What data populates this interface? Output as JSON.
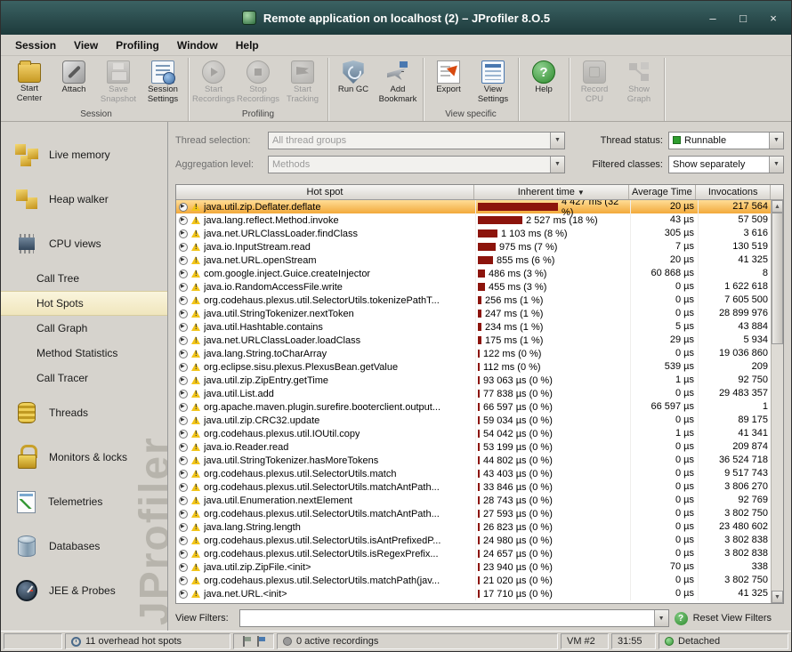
{
  "window": {
    "title": "Remote application on localhost (2) – JProfiler 8.O.5",
    "controls": {
      "minimize": "–",
      "maximize": "□",
      "close": "×"
    }
  },
  "menu": [
    "Session",
    "View",
    "Profiling",
    "Window",
    "Help"
  ],
  "toolbar": {
    "groups": [
      {
        "label": "Session",
        "buttons": [
          {
            "name": "start-center",
            "label": "Start Center",
            "disabled": false
          },
          {
            "name": "attach",
            "label": "Attach",
            "disabled": false
          },
          {
            "name": "save-snapshot",
            "label": "Save Snapshot",
            "disabled": true
          },
          {
            "name": "session-settings",
            "label": "Session Settings",
            "disabled": false
          }
        ]
      },
      {
        "label": "Profiling",
        "buttons": [
          {
            "name": "start-recordings",
            "label": "Start Recordings",
            "disabled": true
          },
          {
            "name": "stop-recordings",
            "label": "Stop Recordings",
            "disabled": true
          },
          {
            "name": "start-tracking",
            "label": "Start Tracking",
            "disabled": true
          }
        ]
      },
      {
        "label": "",
        "buttons": [
          {
            "name": "run-gc",
            "label": "Run GC",
            "disabled": false
          },
          {
            "name": "add-bookmark",
            "label": "Add Bookmark",
            "disabled": false
          }
        ]
      },
      {
        "label": "View specific",
        "buttons": [
          {
            "name": "export",
            "label": "Export",
            "disabled": false
          },
          {
            "name": "view-settings",
            "label": "View Settings",
            "disabled": false
          }
        ]
      },
      {
        "label": "",
        "buttons": [
          {
            "name": "help",
            "label": "Help",
            "disabled": false
          }
        ]
      },
      {
        "label": "",
        "buttons": [
          {
            "name": "record-cpu",
            "label": "Record CPU",
            "disabled": true
          },
          {
            "name": "show-graph",
            "label": "Show Graph",
            "disabled": true
          }
        ]
      }
    ]
  },
  "sidebar": {
    "watermark": "JProfiler",
    "items": [
      {
        "name": "live-memory",
        "label": "Live memory",
        "icon": "memory-blocks-icon",
        "type": "top"
      },
      {
        "name": "heap-walker",
        "label": "Heap walker",
        "icon": "heap-blocks-icon",
        "type": "top"
      },
      {
        "name": "cpu-views",
        "label": "CPU views",
        "icon": "cpu-chip-icon",
        "type": "top"
      },
      {
        "name": "call-tree",
        "label": "Call Tree",
        "type": "sub",
        "selected": false
      },
      {
        "name": "hot-spots",
        "label": "Hot Spots",
        "type": "sub",
        "selected": true
      },
      {
        "name": "call-graph",
        "label": "Call Graph",
        "type": "sub",
        "selected": false
      },
      {
        "name": "method-statistics",
        "label": "Method Statistics",
        "type": "sub",
        "selected": false
      },
      {
        "name": "call-tracer",
        "label": "Call Tracer",
        "type": "sub",
        "selected": false
      },
      {
        "name": "threads",
        "label": "Threads",
        "icon": "thread-spool-icon",
        "type": "top"
      },
      {
        "name": "monitors-locks",
        "label": "Monitors & locks",
        "icon": "padlock-icon",
        "type": "top"
      },
      {
        "name": "telemetries",
        "label": "Telemetries",
        "icon": "telemetry-chart-icon",
        "type": "top"
      },
      {
        "name": "databases",
        "label": "Databases",
        "icon": "database-cylinder-icon",
        "type": "top"
      },
      {
        "name": "jee-probes",
        "label": "JEE & Probes",
        "icon": "gauge-icon",
        "type": "top"
      }
    ]
  },
  "filters": {
    "thread_selection": {
      "label": "Thread selection:",
      "value": "All thread groups",
      "disabled": true
    },
    "aggregation_level": {
      "label": "Aggregation level:",
      "value": "Methods",
      "disabled": true
    },
    "thread_status": {
      "label": "Thread status:",
      "value": "Runnable",
      "disabled": false
    },
    "filtered_classes": {
      "label": "Filtered classes:",
      "value": "Show separately",
      "disabled": false
    }
  },
  "table": {
    "columns": [
      "Hot spot",
      "Inherent time",
      "Average Time",
      "Invocations"
    ],
    "sort_column": "Inherent time",
    "sort_direction": "descending",
    "selected_index": 0,
    "rows": [
      {
        "name": "java.util.zip.Deflater.deflate",
        "time": "4 427 ms (32 %)",
        "pct": 32,
        "avg": "20 µs",
        "inv": "217 564"
      },
      {
        "name": "java.lang.reflect.Method.invoke",
        "time": "2 527 ms (18 %)",
        "pct": 18,
        "avg": "43 µs",
        "inv": "57 509"
      },
      {
        "name": "java.net.URLClassLoader.findClass",
        "time": "1 103 ms (8 %)",
        "pct": 8,
        "avg": "305 µs",
        "inv": "3 616"
      },
      {
        "name": "java.io.InputStream.read",
        "time": "975 ms (7 %)",
        "pct": 7,
        "avg": "7 µs",
        "inv": "130 519"
      },
      {
        "name": "java.net.URL.openStream",
        "time": "855 ms (6 %)",
        "pct": 6,
        "avg": "20 µs",
        "inv": "41 325"
      },
      {
        "name": "com.google.inject.Guice.createInjector",
        "time": "486 ms (3 %)",
        "pct": 3,
        "avg": "60 868 µs",
        "inv": "8"
      },
      {
        "name": "java.io.RandomAccessFile.write",
        "time": "455 ms (3 %)",
        "pct": 3,
        "avg": "0 µs",
        "inv": "1 622 618"
      },
      {
        "name": "org.codehaus.plexus.util.SelectorUtils.tokenizePathT...",
        "time": "256 ms (1 %)",
        "pct": 1,
        "avg": "0 µs",
        "inv": "7 605 500"
      },
      {
        "name": "java.util.StringTokenizer.nextToken",
        "time": "247 ms (1 %)",
        "pct": 1,
        "avg": "0 µs",
        "inv": "28 899 976"
      },
      {
        "name": "java.util.Hashtable.contains",
        "time": "234 ms (1 %)",
        "pct": 1,
        "avg": "5 µs",
        "inv": "43 884"
      },
      {
        "name": "java.net.URLClassLoader.loadClass",
        "time": "175 ms (1 %)",
        "pct": 1,
        "avg": "29 µs",
        "inv": "5 934"
      },
      {
        "name": "java.lang.String.toCharArray",
        "time": "122 ms (0 %)",
        "pct": 0,
        "avg": "0 µs",
        "inv": "19 036 860"
      },
      {
        "name": "org.eclipse.sisu.plexus.PlexusBean.getValue",
        "time": "112 ms (0 %)",
        "pct": 0,
        "avg": "539 µs",
        "inv": "209"
      },
      {
        "name": "java.util.zip.ZipEntry.getTime",
        "time": "93 063 µs (0 %)",
        "pct": 0,
        "avg": "1 µs",
        "inv": "92 750"
      },
      {
        "name": "java.util.List.add",
        "time": "77 838 µs (0 %)",
        "pct": 0,
        "avg": "0 µs",
        "inv": "29 483 357"
      },
      {
        "name": "org.apache.maven.plugin.surefire.booterclient.output...",
        "time": "66 597 µs (0 %)",
        "pct": 0,
        "avg": "66 597 µs",
        "inv": "1"
      },
      {
        "name": "java.util.zip.CRC32.update",
        "time": "59 034 µs (0 %)",
        "pct": 0,
        "avg": "0 µs",
        "inv": "89 175"
      },
      {
        "name": "org.codehaus.plexus.util.IOUtil.copy",
        "time": "54 042 µs (0 %)",
        "pct": 0,
        "avg": "1 µs",
        "inv": "41 341"
      },
      {
        "name": "java.io.Reader.read",
        "time": "53 199 µs (0 %)",
        "pct": 0,
        "avg": "0 µs",
        "inv": "209 874"
      },
      {
        "name": "java.util.StringTokenizer.hasMoreTokens",
        "time": "44 802 µs (0 %)",
        "pct": 0,
        "avg": "0 µs",
        "inv": "36 524 718"
      },
      {
        "name": "org.codehaus.plexus.util.SelectorUtils.match",
        "time": "43 403 µs (0 %)",
        "pct": 0,
        "avg": "0 µs",
        "inv": "9 517 743"
      },
      {
        "name": "org.codehaus.plexus.util.SelectorUtils.matchAntPath...",
        "time": "33 846 µs (0 %)",
        "pct": 0,
        "avg": "0 µs",
        "inv": "3 806 270"
      },
      {
        "name": "java.util.Enumeration.nextElement",
        "time": "28 743 µs (0 %)",
        "pct": 0,
        "avg": "0 µs",
        "inv": "92 769"
      },
      {
        "name": "org.codehaus.plexus.util.SelectorUtils.matchAntPath...",
        "time": "27 593 µs (0 %)",
        "pct": 0,
        "avg": "0 µs",
        "inv": "3 802 750"
      },
      {
        "name": "java.lang.String.length",
        "time": "26 823 µs (0 %)",
        "pct": 0,
        "avg": "0 µs",
        "inv": "23 480 602"
      },
      {
        "name": "org.codehaus.plexus.util.SelectorUtils.isAntPrefixedP...",
        "time": "24 980 µs (0 %)",
        "pct": 0,
        "avg": "0 µs",
        "inv": "3 802 838"
      },
      {
        "name": "org.codehaus.plexus.util.SelectorUtils.isRegexPrefix...",
        "time": "24 657 µs (0 %)",
        "pct": 0,
        "avg": "0 µs",
        "inv": "3 802 838"
      },
      {
        "name": "java.util.zip.ZipFile.<init>",
        "time": "23 940 µs (0 %)",
        "pct": 0,
        "avg": "70 µs",
        "inv": "338"
      },
      {
        "name": "org.codehaus.plexus.util.SelectorUtils.matchPath(jav...",
        "time": "21 020 µs (0 %)",
        "pct": 0,
        "avg": "0 µs",
        "inv": "3 802 750"
      },
      {
        "name": "java.net.URL.<init>",
        "time": "17 710 µs (0 %)",
        "pct": 0,
        "avg": "0 µs",
        "inv": "41 325"
      }
    ]
  },
  "view_filters": {
    "label": "View Filters:",
    "value": "",
    "reset_label": "Reset View Filters"
  },
  "statusbar": {
    "hotspots": "11 overhead hot spots",
    "recordings": "0 active recordings",
    "vm": "VM #2",
    "time": "31:55",
    "state": "Detached"
  },
  "colors": {
    "titlebar": "#2c5253",
    "selected_row_top": "#ffdd96",
    "selected_row_bottom": "#f2a93b",
    "time_bar": "#8c140c",
    "sidebar_selected": "#f5eecb",
    "status_green": "#3a9a3a",
    "warning_yellow": "#f3c518"
  }
}
